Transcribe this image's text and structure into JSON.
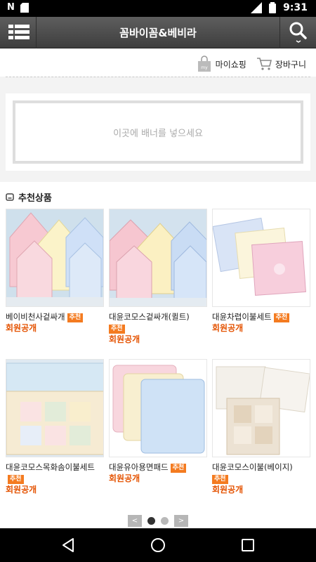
{
  "status_bar": {
    "carrier_icon": "N",
    "lte_label": "LTE",
    "battery_level": "9",
    "time": "9:31"
  },
  "app_bar": {
    "title": "꼼바이꼼&베비라"
  },
  "top_links": {
    "my_shopping": "마이쇼핑",
    "cart": "장바구니",
    "my_badge": "my"
  },
  "banner": {
    "text": "이곳에 배너를 넣으세요"
  },
  "recommended": {
    "title": "추천상품",
    "products": [
      {
        "name": "베이비천사겉싸개",
        "badge": "추천",
        "price": "회원공개"
      },
      {
        "name": "대윤코모스겉싸개(퀼트)",
        "badge": "추천",
        "price": "회원공개"
      },
      {
        "name": "대윤차렵이불세트",
        "badge": "추천",
        "price": "회원공개"
      },
      {
        "name": "대윤코모스목화솜이불세트",
        "badge": "추천",
        "price": "회원공개"
      },
      {
        "name": "대윤유아용면패드",
        "badge": "추천",
        "price": "회원공개"
      },
      {
        "name": "대윤코모스이불(베이지)",
        "badge": "추천",
        "price": "회원공개"
      }
    ]
  },
  "pager": {
    "prev": "<",
    "next": ">"
  },
  "colors": {
    "accent": "#f47b20",
    "price": "#e45200",
    "appbar": "#4a4a4a"
  }
}
